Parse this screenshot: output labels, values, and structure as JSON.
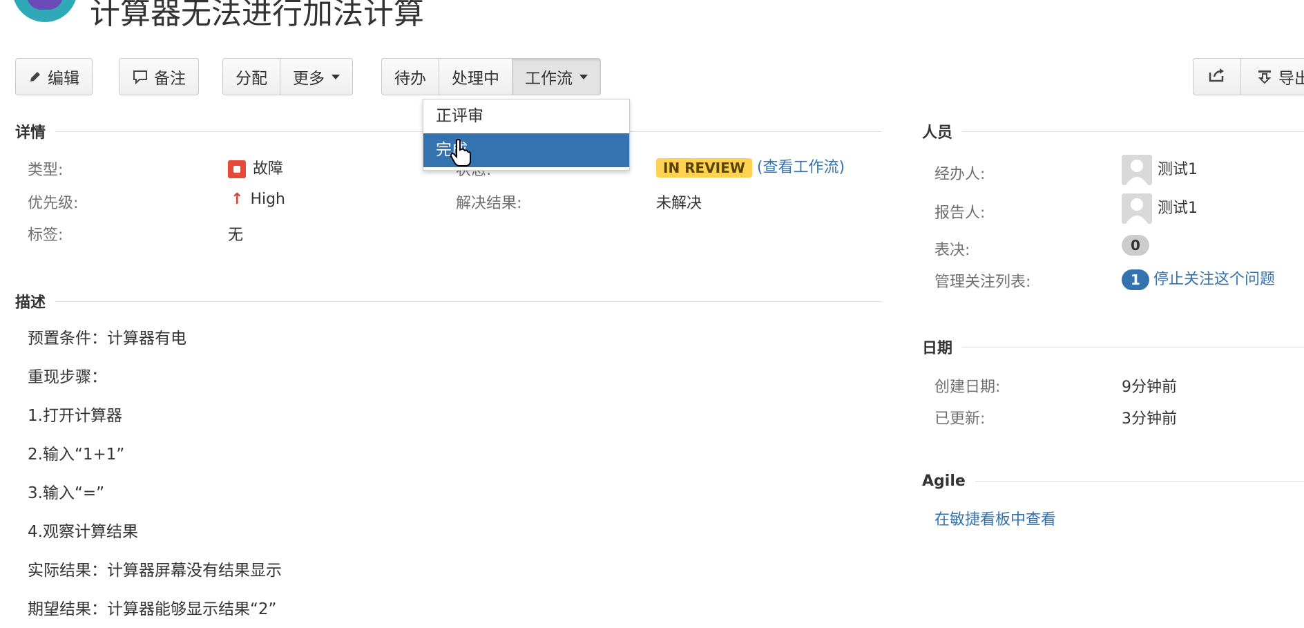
{
  "issue": {
    "title": "计算器无法进行加法计算"
  },
  "toolbar": {
    "edit_label": "编辑",
    "comment_label": "备注",
    "assign_label": "分配",
    "more_label": "更多",
    "todo_label": "待办",
    "in_progress_label": "处理中",
    "workflow_label": "工作流",
    "export_label": "导出"
  },
  "workflow_menu": {
    "items": [
      {
        "label": "正评审",
        "selected": false
      },
      {
        "label": "完成",
        "selected": true
      }
    ]
  },
  "details": {
    "heading": "详情",
    "type_label": "类型:",
    "type_value": "故障",
    "priority_label": "优先级:",
    "priority_value": "High",
    "labels_label": "标签:",
    "labels_value": "无",
    "status_label": "状态:",
    "status_value": "IN REVIEW",
    "view_workflow": "(查看工作流)",
    "resolution_label": "解决结果:",
    "resolution_value": "未解决"
  },
  "description": {
    "heading": "描述",
    "lines": [
      "预置条件：计算器有电",
      "重现步骤：",
      "1.打开计算器",
      "2.输入“1+1”",
      "3.输入“=”",
      "4.观察计算结果",
      "实际结果：计算器屏幕没有结果显示",
      "期望结果：计算器能够显示结果“2”"
    ]
  },
  "people": {
    "heading": "人员",
    "assignee_label": "经办人:",
    "assignee_value": "测试1",
    "reporter_label": "报告人:",
    "reporter_value": "测试1",
    "votes_label": "表决:",
    "votes_value": "0",
    "watchers_label": "管理关注列表:",
    "watchers_count": "1",
    "watchers_action": "停止关注这个问题"
  },
  "dates": {
    "heading": "日期",
    "created_label": "创建日期:",
    "created_value": "9分钟前",
    "updated_label": "已更新:",
    "updated_value": "3分钟前"
  },
  "agile": {
    "heading": "Agile",
    "link": "在敏捷看板中查看"
  },
  "colors": {
    "link": "#3572b0",
    "status_yellow": "#ffd351",
    "bug_red": "#e5493a",
    "priority_red": "#d04437",
    "menu_selected": "#3572b0"
  }
}
